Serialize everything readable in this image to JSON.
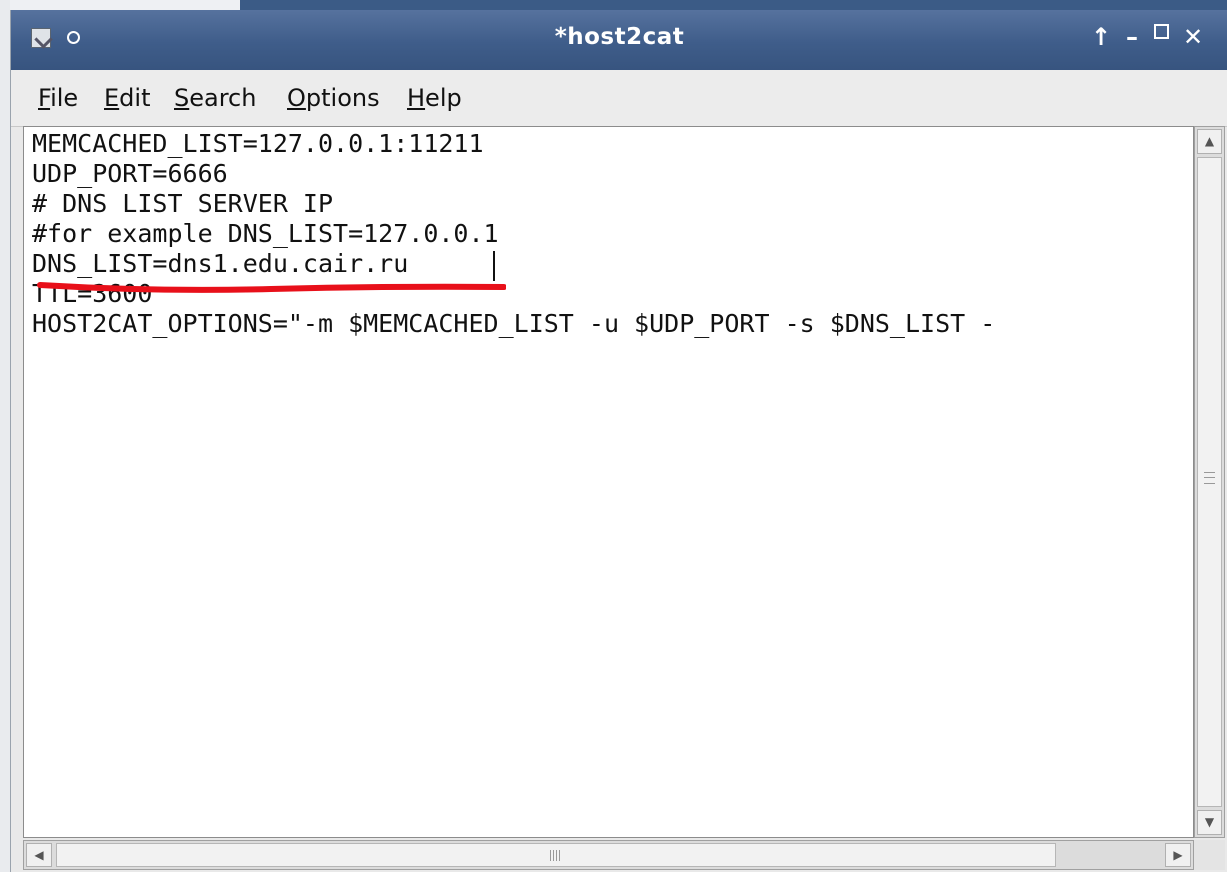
{
  "window": {
    "title": "*host2cat",
    "controls": {
      "up": "↑",
      "minimize": "–",
      "close": "✕"
    },
    "icons": [
      "window-menu-icon",
      "sticky-icon"
    ]
  },
  "menubar": {
    "items": [
      {
        "mnemonic": "F",
        "rest": "ile"
      },
      {
        "mnemonic": "E",
        "rest": "dit"
      },
      {
        "mnemonic": "S",
        "rest": "earch"
      },
      {
        "mnemonic": "O",
        "rest": "ptions"
      },
      {
        "mnemonic": "H",
        "rest": "elp"
      }
    ]
  },
  "editor": {
    "lines": [
      "MEMCACHED_LIST=127.0.0.1:11211",
      "UDP_PORT=6666",
      "# DNS LIST SERVER IP",
      "#for example DNS_LIST=127.0.0.1",
      "DNS_LIST=dns1.edu.cair.ru",
      "TTL=3600",
      "HOST2CAT_OPTIONS=\"-m $MEMCACHED_LIST -u $UDP_PORT -s $DNS_LIST -"
    ],
    "annotation_color": "#e8101a"
  },
  "scrollbars": {
    "up_arrow": "▲",
    "down_arrow": "▼",
    "left_arrow": "◀",
    "right_arrow": "▶"
  }
}
